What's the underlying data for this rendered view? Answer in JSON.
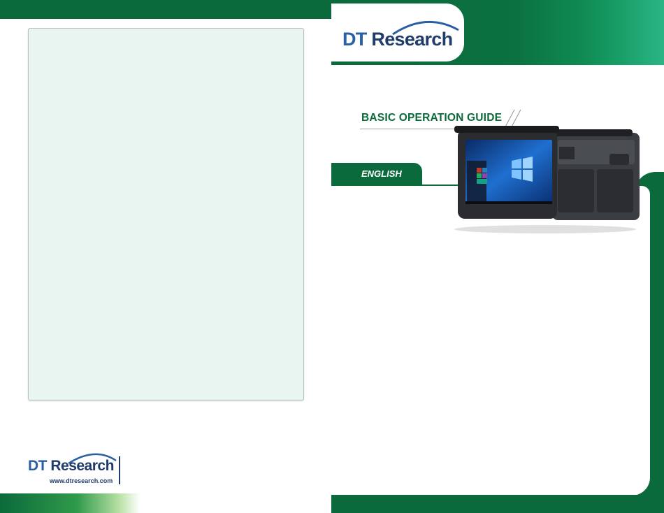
{
  "brand": {
    "logo_dt": "DT",
    "logo_research": "Research",
    "website": "www.dtresearch.com"
  },
  "cover": {
    "title": "BASIC OPERATION GUIDE",
    "language": "ENGLISH"
  },
  "colors": {
    "brand_green": "#0b6a3b",
    "brand_blue": "#2a5fa3",
    "brand_navy": "#1f3c6b",
    "notes_background": "#e8f5f1"
  },
  "icons": {
    "logo_arc": "swoosh-arc",
    "product_image": "rugged-tablet"
  }
}
